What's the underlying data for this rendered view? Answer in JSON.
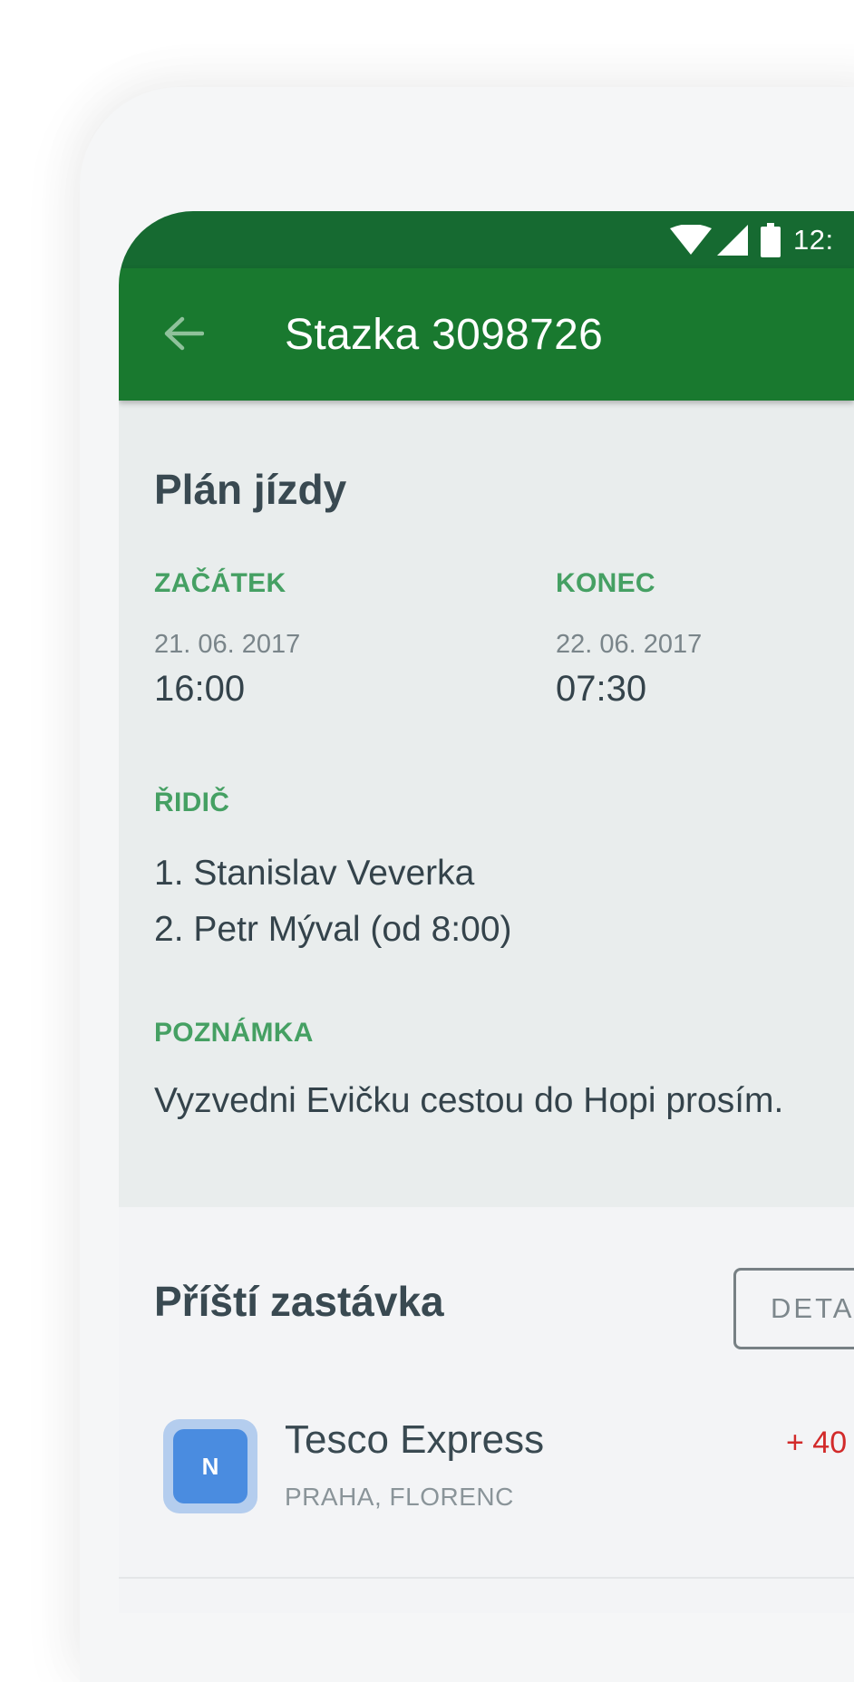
{
  "status_bar": {
    "time": "12:",
    "icons": [
      "wifi-icon",
      "cell-signal-icon",
      "battery-icon"
    ]
  },
  "app_bar": {
    "title": "Stazka 3098726",
    "back_icon": "back-arrow-icon"
  },
  "plan": {
    "heading": "Plán jízdy",
    "start": {
      "label": "ZAČÁTEK",
      "date": "21. 06. 2017",
      "time": "16:00"
    },
    "end": {
      "label": "KONEC",
      "date": "22. 06. 2017",
      "time": "07:30"
    },
    "driver": {
      "label": "ŘIDIČ",
      "items": [
        "1. Stanislav Veverka",
        "2. Petr Mýval (od 8:00)"
      ]
    },
    "note": {
      "label": "POZNÁMKA",
      "text": "Vyzvedni Evičku cestou do Hopi prosím."
    }
  },
  "next_stop": {
    "heading": "Příští zastávka",
    "detail_button": "DETA",
    "stop": {
      "badge": "N",
      "name": "Tesco Express",
      "location": "PRAHA, FLORENC",
      "delay": "+ 40"
    }
  },
  "colors": {
    "app_bar": "#19792f",
    "status_bar": "#166a31",
    "label_green": "#45a063",
    "delay_red": "#d22a2a",
    "badge_blue": "#4a8ce0"
  }
}
